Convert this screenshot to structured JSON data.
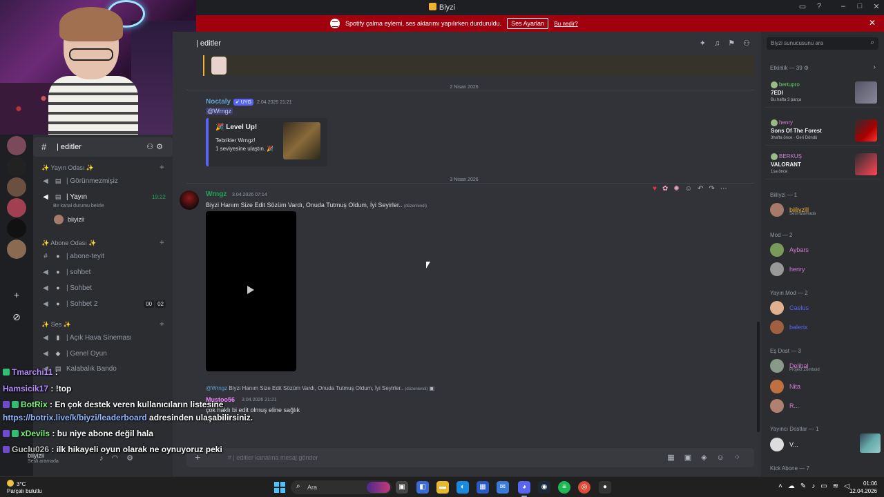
{
  "window": {
    "title": "Biyzi"
  },
  "banner": {
    "text": "Spotify çalma eylemi, ses aktarımı yapılırken durduruldu.",
    "button": "Ses Ayarları",
    "link": "Bu nedir?"
  },
  "channel_header": {
    "title": "| editler"
  },
  "sidebar": {
    "header": {
      "channel": "| editler"
    },
    "categories": [
      {
        "label": "✨ Yayın Odası ✨",
        "channels": [
          {
            "icon": "speaker-icon",
            "label": "| Görünmezmişiz"
          },
          {
            "icon": "speaker-icon",
            "label": "| Yayın",
            "timer": "19:22",
            "status": "Bir kanal durumu belirle",
            "user": "biiyizii"
          }
        ]
      },
      {
        "label": "✨ Abone Odası ✨",
        "channels": [
          {
            "icon": "hash-icon",
            "label": "| abone-teyit"
          },
          {
            "icon": "speaker-icon",
            "label": "| sohbet"
          },
          {
            "icon": "speaker-icon",
            "label": "| Sohbet"
          },
          {
            "icon": "speaker-icon",
            "label": "| Sohbet 2",
            "counts": [
              "00",
              "02"
            ]
          }
        ]
      },
      {
        "label": "✨ Ses ✨",
        "channels": [
          {
            "icon": "speaker-icon",
            "label": "| Açık Hava Sineması"
          },
          {
            "icon": "speaker-icon",
            "label": "| Genel Oyun"
          },
          {
            "icon": "speaker-icon",
            "label": "Kalabalık Bando"
          }
        ]
      }
    ]
  },
  "stream_chat": [
    {
      "user": "Tmarchi11",
      "sep": " : ",
      "text": ""
    },
    {
      "user": "Hamsicik17",
      "sep": " : ",
      "text": "!top"
    },
    {
      "user": "BotRix",
      "sep": " : ",
      "text": "En çok destek veren kullanıcıların listesine"
    },
    {
      "user": "",
      "sep": "",
      "link": "https://botrix.live/k/biyzi/leaderboard",
      "text": " adresinden ulaşabilirsiniz."
    },
    {
      "user": "xDevils",
      "sep": " : ",
      "text": "bu niye abone değil hala"
    },
    {
      "user": "Guclu026",
      "sep": " : ",
      "text": "ilk hikayeli oyun olarak ne oynuyoruz peki"
    }
  ],
  "user_panel": {
    "name": "biiyizii",
    "status": "Sesli aramada"
  },
  "messages": {
    "divider1": "2 Nisan 2026",
    "msg1": {
      "author": "Noctaly",
      "badge": "✔ UYG",
      "time": "2.04.2026 21:21",
      "mention": "@Wrngz",
      "embed": {
        "title": "🎉 Level Up!",
        "line1": "Tebrikler Wrngz!",
        "line2": "1 seviyesine ulaştın. 🎉"
      }
    },
    "divider2": "3 Nisan 2026",
    "msg2": {
      "author": "Wrngz",
      "time": "3.04.2026 07:14",
      "text": "Biyzi Hanım Size Edit Sözüm Vardı, Onuda Tutmuş Oldum, İyi Seyirler..",
      "edited": "(düzenlendi)"
    },
    "reply": {
      "ref_user": "@Wrngz",
      "ref_text": "Biyzi Hanım Size Edit Sözüm Vardı, Onuda Tutmuş Oldum, İyi Seyirler..",
      "ref_edited": "(düzenlendi)",
      "author": "Mustoo56",
      "time": "3.04.2026 21:21",
      "text": "çok haklı bi edit olmuş eline sağlık"
    }
  },
  "composer": {
    "placeholder": "# | editler kanalına mesaj gönder"
  },
  "right": {
    "search_placeholder": "Biyzi sunucusunu ara",
    "activity_header": "Etkinlik — 39 ⚙",
    "activities": [
      {
        "user": "bertupro",
        "game": "7EDI",
        "sub": "Bu hafta 3 parça",
        "color": "#6bd16b"
      },
      {
        "user": "henry",
        "game": "Sons Of The Forest",
        "sub": "3hafta önce · Geri Döndü",
        "color": "#d37bd3"
      },
      {
        "user": "BERKUŞ",
        "game": "VALORANT",
        "sub": "1sa önce",
        "color": "#d37bd3"
      }
    ],
    "groups": [
      {
        "label": "Biiliyzi — 1",
        "members": [
          {
            "name": "biiliyzill",
            "status": "Sesli aramada",
            "color": "#f0b232"
          }
        ]
      },
      {
        "label": "Mod — 2",
        "members": [
          {
            "name": "Aybars",
            "color": "#d37bd3"
          },
          {
            "name": "henry",
            "color": "#d37bd3"
          }
        ]
      },
      {
        "label": "Yayın Mod — 2",
        "members": [
          {
            "name": "Caelus",
            "color": "#5865f2"
          },
          {
            "name": "balerix",
            "color": "#5865f2"
          }
        ]
      },
      {
        "label": "Eş Dost — 3",
        "members": [
          {
            "name": "Delibal",
            "status": "Project Zomboid",
            "color": "#d37bd3"
          },
          {
            "name": "Nita",
            "color": "#d37bd3"
          },
          {
            "name": "R...",
            "color": "#d37bd3"
          }
        ]
      },
      {
        "label": "Yayıncı Dostlar — 1",
        "members": [
          {
            "name": "V...",
            "color": "#f2f3f5"
          }
        ]
      },
      {
        "label": "Kick Abone — 7",
        "members": []
      }
    ]
  },
  "taskbar": {
    "weather_temp": "3°C",
    "weather_text": "Parçalı bulutlu",
    "search_placeholder": "Ara",
    "time": "01:06",
    "date": "12.04.2026"
  },
  "colors": {
    "banner": "#a1000f",
    "accent": "#5865f2",
    "online": "#23a55a"
  }
}
